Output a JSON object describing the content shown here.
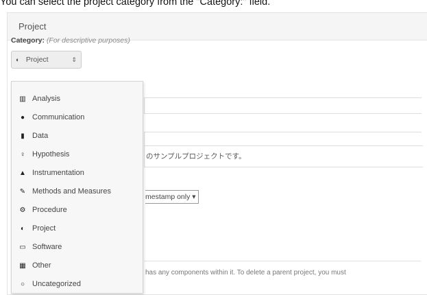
{
  "caption": "You can select the project category from the \"Category:\" field.",
  "panel": {
    "title": "Project",
    "category_label": "Category:",
    "category_hint": "(For descriptive purposes)",
    "selected_category": "Project",
    "selected_icon": "project-icon"
  },
  "dropdown": {
    "items": [
      {
        "label": "Analysis",
        "icon": "bar-chart-icon"
      },
      {
        "label": "Communication",
        "icon": "comment-icon"
      },
      {
        "label": "Data",
        "icon": "database-icon"
      },
      {
        "label": "Hypothesis",
        "icon": "lightbulb-icon"
      },
      {
        "label": "Instrumentation",
        "icon": "flask-icon"
      },
      {
        "label": "Methods and Measures",
        "icon": "pencil-icon"
      },
      {
        "label": "Procedure",
        "icon": "cogs-icon"
      },
      {
        "label": "Project",
        "icon": "project-icon"
      },
      {
        "label": "Software",
        "icon": "laptop-icon"
      },
      {
        "label": "Other",
        "icon": "grid-icon"
      },
      {
        "label": "Uncategorized",
        "icon": "circle-icon"
      }
    ]
  },
  "description_fragment": "のサンプルプロジェクトです。",
  "wiki_select_value": "mestamp only",
  "warning_fragment": "has any components within it. To delete a parent project, you must"
}
